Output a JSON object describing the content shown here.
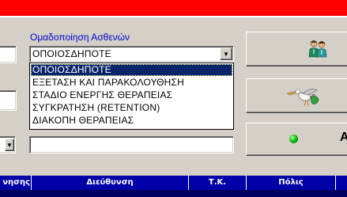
{
  "window": {
    "title_bar_color": "#ff0000"
  },
  "patient_grouping": {
    "label": "Ομαδοποίηση Ασθενών",
    "selected_value": "ΟΠΟΙΟΣΔΗΠΟΤΕ",
    "options": [
      "ΟΠΟΙΟΣΔΗΠΟΤΕ",
      "ΕΞΕΤΑΣΗ ΚΑΙ ΠΑΡΑΚΟΛΟΥΘΗΣΗ",
      "ΣΤΑΔΙΟ ΕΝΕΡΓΗΣ ΘΕΡΑΠΕΙΑΣ",
      "ΣΥΓΚΡΑΤΗΣΗ (RETENTION)",
      "ΔΙΑΚΟΠΗ ΘΕΡΑΠΕΙΑΣ"
    ],
    "highlighted_option": "ΟΠΟΙΟΣΔΗΠΟΤΕ"
  },
  "buttons": {
    "patients_icon": "people-icon",
    "stork_icon": "stork-icon",
    "action_label_partial": "A"
  },
  "grid": {
    "columns": [
      "νησης",
      "Διεύθυνση",
      "Τ.Κ.",
      "Πόλις"
    ],
    "header_color": "#0000a8"
  }
}
